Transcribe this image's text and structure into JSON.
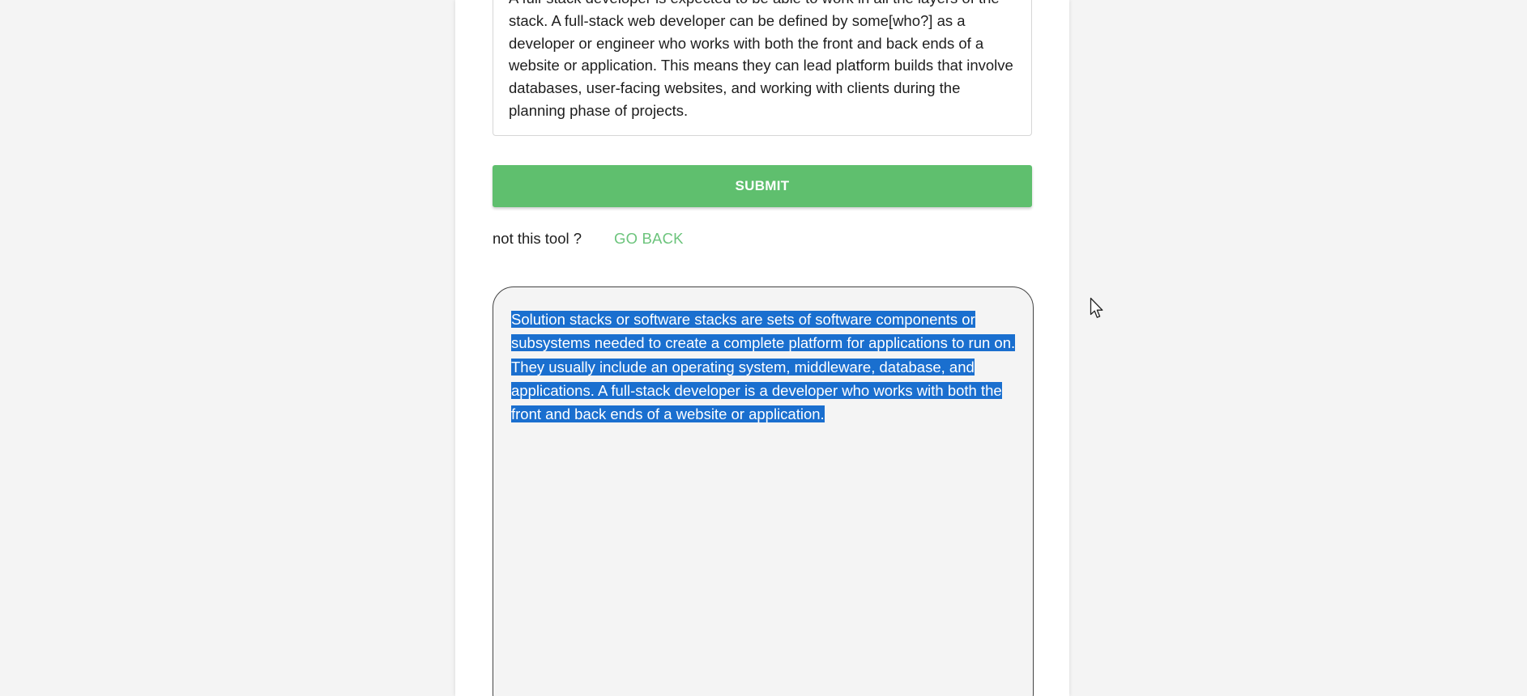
{
  "input": {
    "text": "A full-stack developer is expected to be able to work in all the layers of the stack. A full-stack web developer can be defined by some[who?] as a developer or engineer who works with both the front and back ends of a website or application. This means they can lead platform builds that involve databases, user-facing websites, and working with clients during the planning phase of projects."
  },
  "actions": {
    "submit_label": "SUBMIT",
    "not_this_tool": "not this tool ?",
    "go_back_label": "GO BACK"
  },
  "output": {
    "text": "Solution stacks or software stacks are sets of software components or subsystems needed to create a complete platform for applications to run on. They usually include an operating system, middleware, database, and applications. A full-stack developer is a developer who works with both the front and back ends of a website or application."
  },
  "colors": {
    "accent_green": "#5fbf6e",
    "link_green": "#6cc47c",
    "selection_blue": "#1a6fcf",
    "page_background": "#f4f4f4"
  },
  "icons": {
    "cursor": "mouse-pointer-icon"
  }
}
